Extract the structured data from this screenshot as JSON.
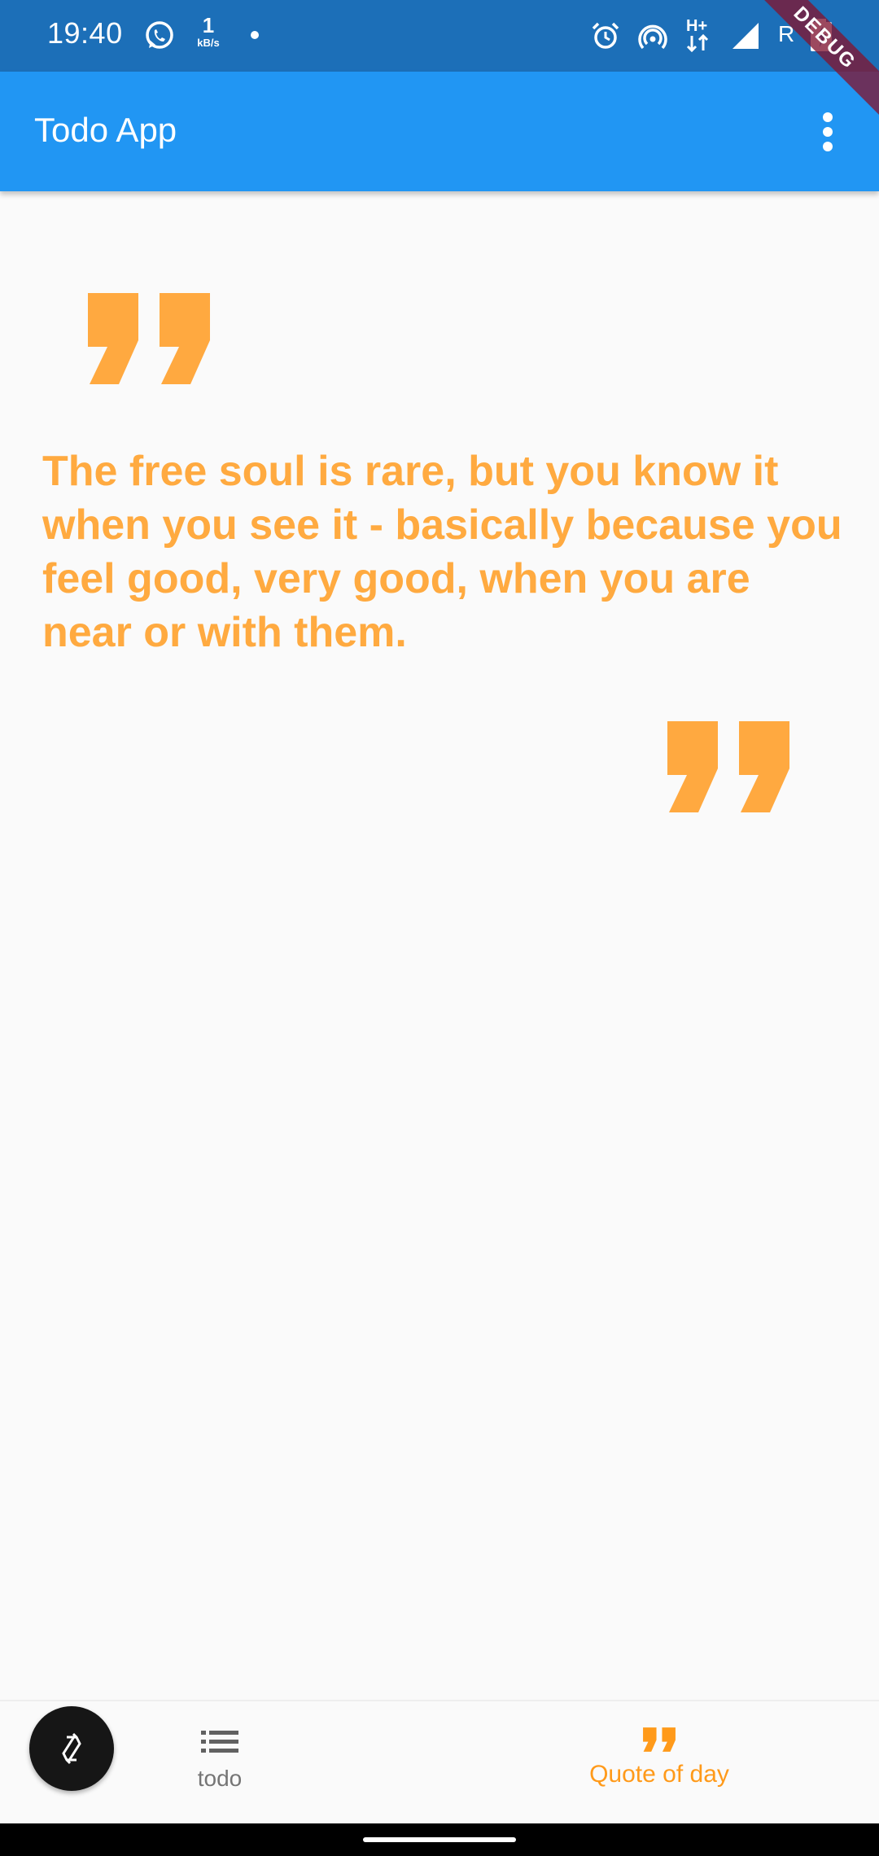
{
  "status_bar": {
    "time": "19:40",
    "net_speed_value": "1",
    "net_speed_unit": "kB/s",
    "carrier": "R",
    "icons": [
      "whatsapp-icon",
      "alarm-icon",
      "hotspot-icon",
      "h-plus-data-icon",
      "signal-icon",
      "battery-charging-icon"
    ]
  },
  "debug_banner": "DEBUG",
  "app_bar": {
    "title": "Todo App",
    "menu_icon": "more-vert-icon"
  },
  "quote": {
    "text": "The free soul is rare, but you know it when you see it - basically because you feel good, very good, when you are near or with them."
  },
  "fab": {
    "icon": "refresh-icon"
  },
  "bottom_nav": {
    "items": [
      {
        "label": "todo",
        "icon": "list-icon",
        "selected": false
      },
      {
        "label": "Quote of day",
        "icon": "format-quote-icon",
        "selected": true
      }
    ]
  },
  "colors": {
    "status_bar": "#1c6fb8",
    "app_bar": "#2196f3",
    "accent": "#ffa940",
    "nav_selected": "#ff9a1a",
    "nav_unselected": "#757575"
  }
}
